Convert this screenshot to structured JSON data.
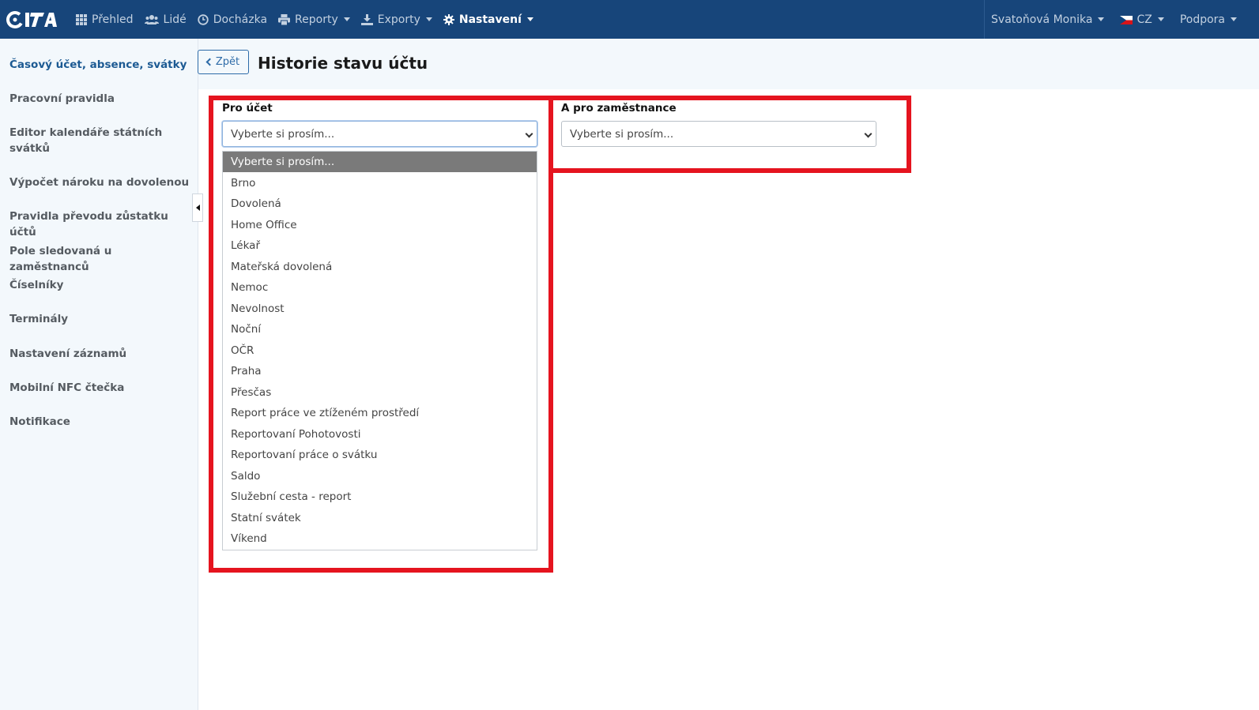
{
  "app": {
    "logo_text": "iTA",
    "colors": {
      "navbar": "#17457a",
      "accent": "#1c5a93",
      "highlight": "#e5141f",
      "selected_option": "#7a7a7a"
    }
  },
  "nav": {
    "items": [
      {
        "label": "Přehled",
        "icon": "grid-icon"
      },
      {
        "label": "Lidé",
        "icon": "users-icon"
      },
      {
        "label": "Docházka",
        "icon": "clock-icon"
      },
      {
        "label": "Reporty",
        "icon": "printer-icon"
      },
      {
        "label": "Exporty",
        "icon": "export-icon"
      },
      {
        "label": "Nastavení",
        "icon": "gear-icon"
      }
    ],
    "user": "Svatoňová Monika",
    "language": "CZ",
    "support": "Podpora"
  },
  "sidebar": {
    "items": [
      {
        "label": "Časový účet, absence, svátky"
      },
      {
        "label": "Pracovní pravidla"
      },
      {
        "label": "Editor kalendáře státních svátků"
      },
      {
        "label": "Výpočet nároku na dovolenou"
      },
      {
        "label": "Pravidla převodu zůstatku účtů"
      },
      {
        "label": "Pole sledovaná u zaměstnanců"
      },
      {
        "label": "Číselníky"
      },
      {
        "label": "Terminály"
      },
      {
        "label": "Nastavení záznamů"
      },
      {
        "label": "Mobilní NFC čtečka"
      },
      {
        "label": "Notifikace"
      }
    ]
  },
  "header": {
    "back_label": "Zpět",
    "title": "Historie stavu účtu"
  },
  "form": {
    "account_label": "Pro účet",
    "account_selected": "Vyberte si prosím...",
    "employee_label": "A pro zaměstnance",
    "employee_selected": "Vyberte si prosím...",
    "account_options": [
      "Vyberte si prosím...",
      "Brno",
      "Dovolená",
      "Home Office",
      "Lékař",
      "Mateřská dovolená",
      "Nemoc",
      "Nevolnost",
      "Noční",
      "OČR",
      "Praha",
      "Přesčas",
      "Report práce ve ztíženém prostředí",
      "Reportovaní Pohotovosti",
      "Reportovaní práce o svátku",
      "Saldo",
      "Služební cesta - report",
      "Statní svátek",
      "Víkend"
    ]
  }
}
